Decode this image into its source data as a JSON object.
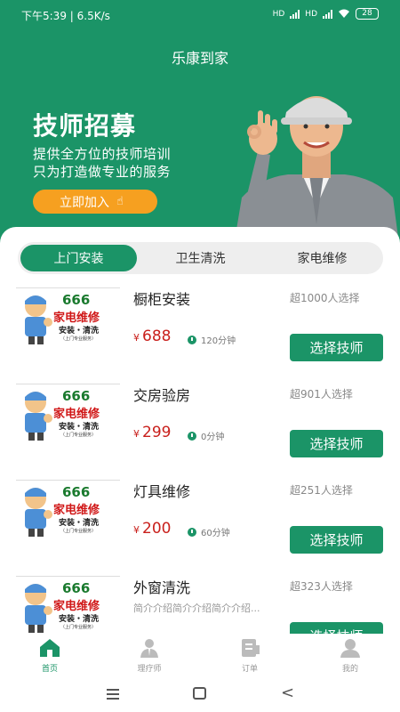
{
  "status_bar": {
    "time_speed": "下午5:39 | 6.5K/s",
    "battery": "28"
  },
  "app": {
    "title": "乐康到家"
  },
  "banner": {
    "title": "技师招募",
    "line1": "提供全方位的技师培训",
    "line2": "只为打造做专业的服务",
    "join_label": "立即加入"
  },
  "tabs": [
    {
      "label": "上门安装",
      "active": true
    },
    {
      "label": "卫生清洗",
      "active": false
    },
    {
      "label": "家电维修",
      "active": false
    }
  ],
  "thumbnail": {
    "number": "666",
    "title": "家电维修",
    "subtitle": "安装・清洗",
    "tagline": "（上门专业服务）"
  },
  "services": [
    {
      "name": "橱柜安装",
      "count": "超1000人选择",
      "price": "688",
      "duration": "120分钟",
      "button": "选择技师",
      "description": ""
    },
    {
      "name": "交房验房",
      "count": "超901人选择",
      "price": "299",
      "duration": "0分钟",
      "button": "选择技师",
      "description": ""
    },
    {
      "name": "灯具维修",
      "count": "超251人选择",
      "price": "200",
      "duration": "60分钟",
      "button": "选择技师",
      "description": ""
    },
    {
      "name": "外窗清洗",
      "count": "超323人选择",
      "price": "",
      "duration": "",
      "button": "选择技师",
      "description": "简介介绍简介介绍简介介绍..."
    }
  ],
  "price_symbol": "¥",
  "bottom_nav": [
    {
      "label": "首页",
      "icon": "home-icon",
      "active": true
    },
    {
      "label": "理疗师",
      "icon": "therapist-icon",
      "active": false
    },
    {
      "label": "订单",
      "icon": "order-icon",
      "active": false
    },
    {
      "label": "我的",
      "icon": "profile-icon",
      "active": false
    }
  ],
  "colors": {
    "primary": "#1b9467",
    "accent": "#f6a020",
    "price": "#c9201c"
  }
}
